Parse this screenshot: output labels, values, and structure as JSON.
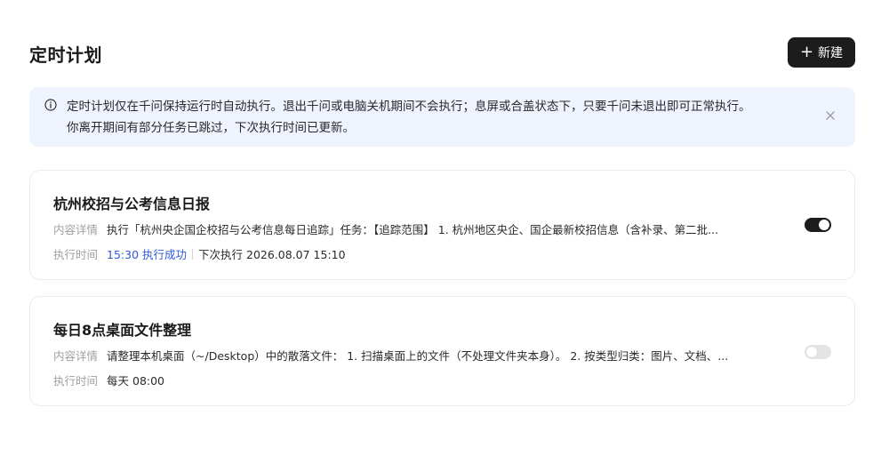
{
  "header": {
    "title": "定时计划",
    "new_button_label": "新建",
    "new_button_icon": "plus-icon"
  },
  "notice": {
    "icon": "info-icon",
    "line1": "定时计划仅在千问保持运行时自动执行。退出千问或电脑关机期间不会执行；息屏或合盖状态下，只要千问未退出即可正常执行。",
    "line2": "你离开期间有部分任务已跳过，下次执行时间已更新。",
    "close_icon": "close-icon"
  },
  "labels": {
    "detail": "内容详情",
    "time": "执行时间"
  },
  "plans": [
    {
      "title": "杭州校招与公考信息日报",
      "detail": "执行「杭州央企国企校招与公考信息每日追踪」任务：【追踪范围】 1. 杭州地区央企、国企最新校招信息（含补录、第二批...",
      "last_run": "15:30 执行成功",
      "next_run": "下次执行 2026.08.07 15:10",
      "enabled": true
    },
    {
      "title": "每日8点桌面文件整理",
      "detail": "请整理本机桌面（~/Desktop）中的散落文件： 1. 扫描桌面上的文件（不处理文件夹本身）。 2. 按类型归类：图片、文档、...",
      "schedule": "每天 08:00",
      "enabled": false
    }
  ],
  "colors": {
    "notice_bg": "#eef3fe",
    "success_text": "#2f58e0",
    "button_bg": "#1c1c1c",
    "toggle_on": "#1c1c1c",
    "toggle_off": "#e4e4e4"
  }
}
